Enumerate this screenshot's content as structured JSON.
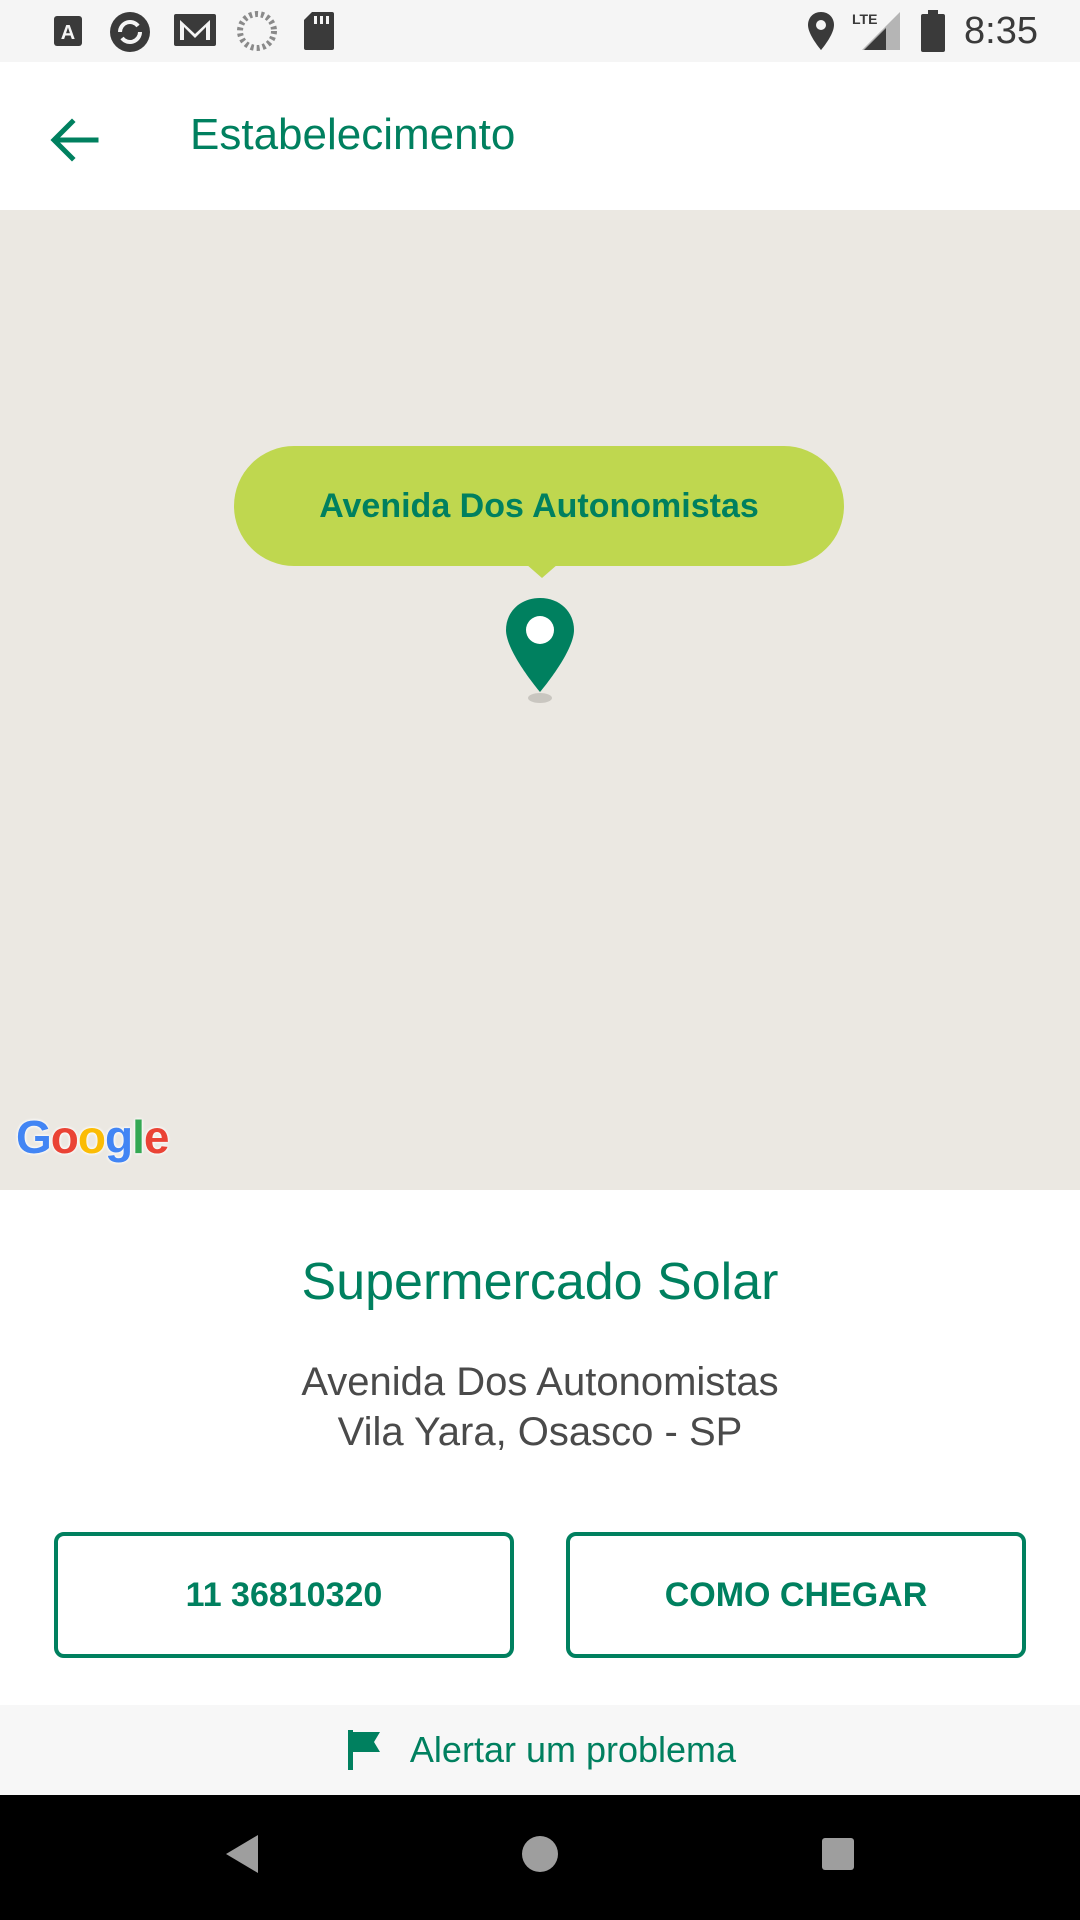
{
  "status_bar": {
    "time": "8:35",
    "left_icons": [
      "font-download-icon",
      "sync-circle-icon",
      "gmail-icon",
      "loading-spinner-icon",
      "sd-card-icon"
    ],
    "right_icons": [
      "location-icon",
      "lte-signal-icon",
      "battery-icon"
    ],
    "network_label": "LTE"
  },
  "app_bar": {
    "title": "Estabelecimento",
    "back_icon": "arrow-back-icon"
  },
  "map": {
    "bubble_label": "Avenida Dos Autonomistas",
    "pin_icon": "map-pin-icon",
    "attribution": "Google"
  },
  "store": {
    "name": "Supermercado Solar",
    "address_line1": "Avenida Dos Autonomistas",
    "address_line2": "Vila Yara, Osasco - SP"
  },
  "actions": {
    "phone_label": "11 36810320",
    "directions_label": "COMO CHEGAR"
  },
  "alert": {
    "label": "Alertar um problema",
    "icon": "flag-icon"
  },
  "nav_bar": {
    "buttons": [
      "back-triangle-icon",
      "home-circle-icon",
      "recents-square-icon"
    ]
  },
  "colors": {
    "primary": "#00805f",
    "bubble": "#bfd74f",
    "map_background": "#ebe8e2"
  }
}
